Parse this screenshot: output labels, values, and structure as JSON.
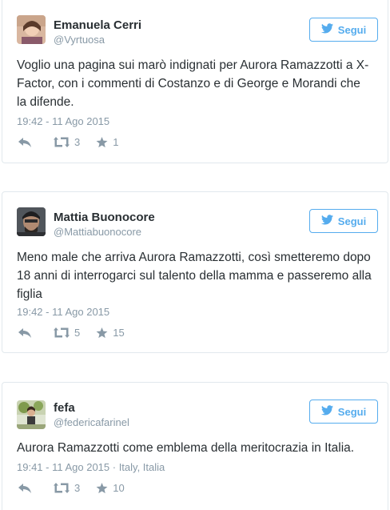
{
  "follow_label": "Segui",
  "colors": {
    "accent": "#55acee",
    "meta": "#8899a6",
    "text": "#292f33",
    "border": "#e1e8ed"
  },
  "tweets": [
    {
      "name": "Emanuela Cerri",
      "handle": "@Vyrtuosa",
      "text": "Voglio una pagina sui marò indignati per Aurora Ramazzotti a X-Factor, con i commenti di Costanzo e di George e Morandi che la difende.",
      "time": "19:42 - 11 Ago 2015",
      "retweets": "3",
      "favorites": "1"
    },
    {
      "name": "Mattia Buonocore",
      "handle": "@Mattiabuonocore",
      "text": "Meno male che arriva Aurora Ramazzotti, così smetteremo dopo 18 anni di interrogarci sul talento della mamma e passeremo alla figlia",
      "time": "19:42 - 11 Ago 2015",
      "retweets": "5",
      "favorites": "15"
    },
    {
      "name": "fefa",
      "handle": "@federicafarinel",
      "text": "Aurora Ramazzotti come emblema della meritocrazia in Italia.",
      "time": "19:41 - 11 Ago 2015 · Italy, Italia",
      "retweets": "3",
      "favorites": "10"
    }
  ]
}
